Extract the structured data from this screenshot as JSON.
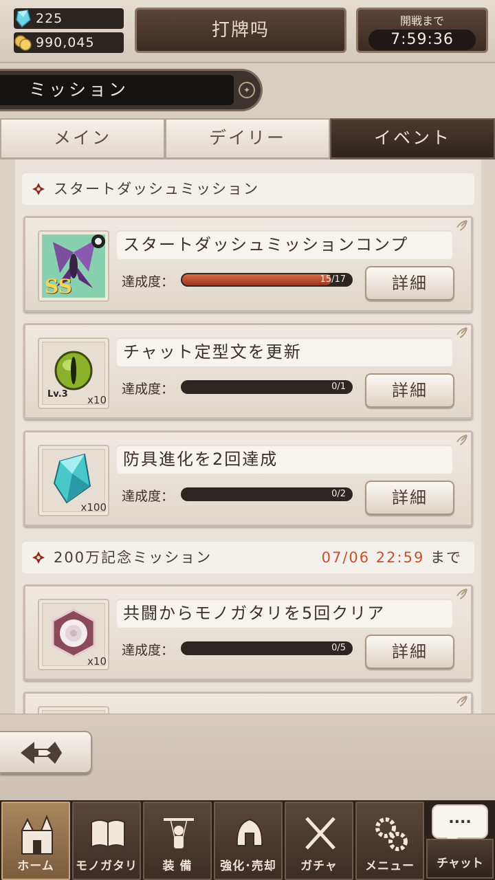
{
  "status": {
    "gems": "225",
    "gold": "990,045",
    "title": "打牌吗",
    "battle_label": "開戦まで",
    "battle_timer": "7:59:36"
  },
  "header": {
    "title": "ミッション"
  },
  "tabs": [
    {
      "label": "メイン",
      "active": false
    },
    {
      "label": "デイリー",
      "active": false
    },
    {
      "label": "イベント",
      "active": true
    }
  ],
  "sections": [
    {
      "title": "スタートダッシュミッション"
    },
    {
      "title": "200万記念ミッション",
      "deadline_date": "07/06 22:59",
      "deadline_suffix": "まで"
    }
  ],
  "progress_label": "達成度：",
  "detail_label": "詳細",
  "missions": [
    {
      "name": "スタートダッシュミッションコンプ",
      "progress_text": "15/17",
      "progress": 0.882,
      "reward_icon": "fairy-card-icon",
      "reward_badge": "SS",
      "reward_qty": ""
    },
    {
      "name": "チャット定型文を更新",
      "progress_text": "0/1",
      "progress": 0,
      "reward_icon": "green-eye-orb-icon",
      "reward_level": "Lv.3",
      "reward_qty": "x10"
    },
    {
      "name": "防具進化を2回達成",
      "progress_text": "0/2",
      "progress": 0,
      "reward_icon": "teal-crystal-icon",
      "reward_qty": "x100"
    },
    {
      "name": "共闘からモノガタリを5回クリア",
      "progress_text": "0/5",
      "progress": 0,
      "reward_icon": "rose-medallion-icon",
      "reward_qty": "x10"
    }
  ],
  "nav": [
    {
      "label": "ホーム",
      "icon": "castle-icon",
      "active": true
    },
    {
      "label": "モノガタリ",
      "icon": "book-icon",
      "active": false
    },
    {
      "label": "装 備",
      "icon": "puppet-icon",
      "active": false
    },
    {
      "label": "強化･売却",
      "icon": "helmet-icon",
      "active": false
    },
    {
      "label": "ガチャ",
      "icon": "crossed-swords-icon",
      "active": false
    },
    {
      "label": "メニュー",
      "icon": "gears-icon",
      "active": false
    }
  ],
  "chat": {
    "bubble": "....",
    "label": "チャット"
  },
  "colors": {
    "accent_deadline": "#c8502c",
    "progress_fill": "#c04a2a",
    "active_tab": "#3a2b24"
  }
}
